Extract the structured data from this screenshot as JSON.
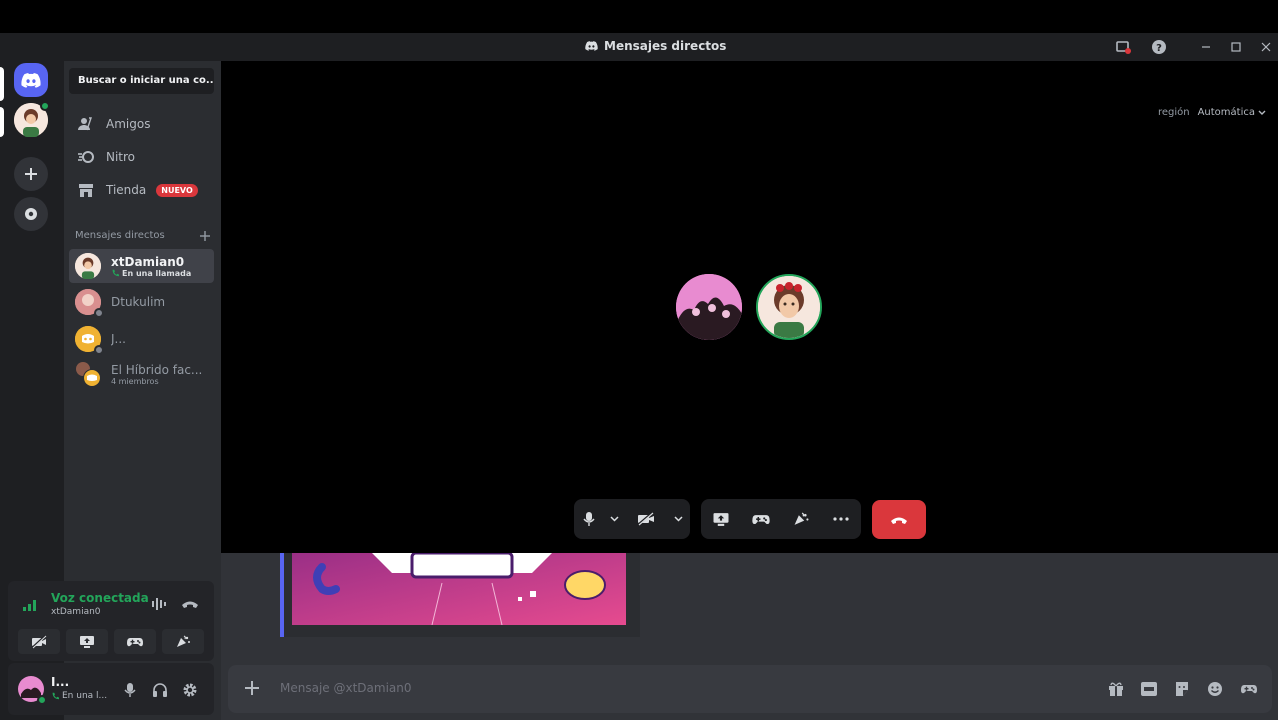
{
  "window": {
    "title": "Mensajes directos"
  },
  "sidebar": {
    "search_placeholder": "Buscar o iniciar una co...",
    "nav": [
      {
        "label": "Amigos",
        "icon": "friends-icon"
      },
      {
        "label": "Nitro",
        "icon": "nitro-icon"
      },
      {
        "label": "Tienda",
        "icon": "shop-icon",
        "badge": "NUEVO"
      }
    ],
    "dm_header": "Mensajes directos",
    "dms": [
      {
        "name": "xtDamian0",
        "sub": "En una llamada",
        "active": true
      },
      {
        "name": "Dtukulim",
        "sub": ""
      },
      {
        "name": "J...",
        "sub": ""
      },
      {
        "name": "El Híbrido fac...",
        "sub": "4 miembros"
      }
    ]
  },
  "voice": {
    "title": "Voz conectada",
    "channel": "xtDamian0"
  },
  "user": {
    "name": "I...",
    "status": "En una l..."
  },
  "call": {
    "region_label": "región",
    "region_value": "Automática"
  },
  "composer": {
    "placeholder": "Mensaje @xtDamian0"
  },
  "colors": {
    "brand": "#5865f2",
    "danger": "#da373c",
    "online": "#23a55a"
  }
}
